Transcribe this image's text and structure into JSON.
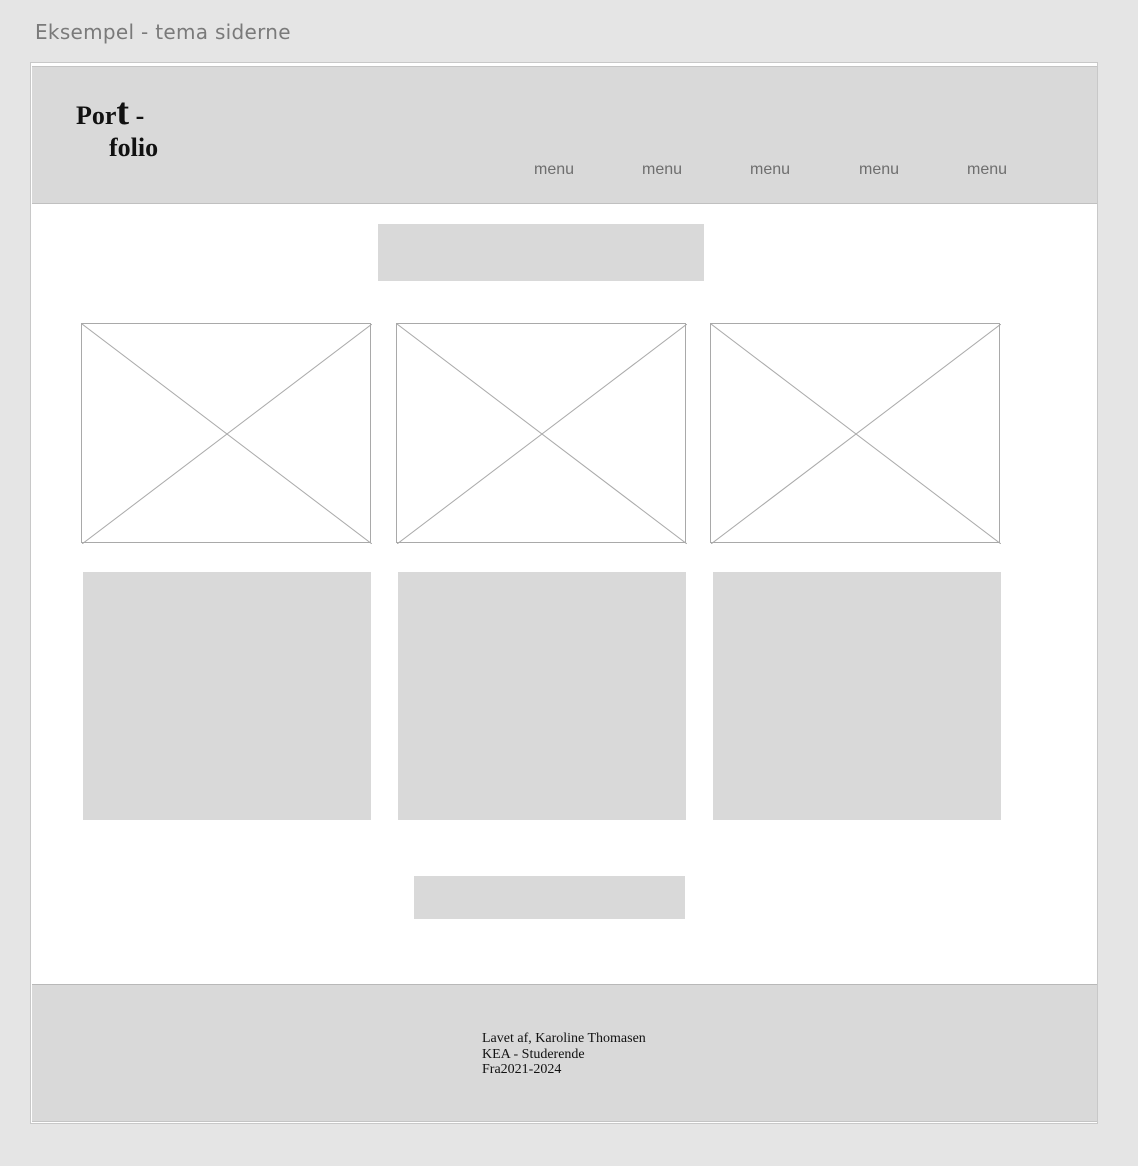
{
  "artboard_title": "Eksempel - tema siderne",
  "header": {
    "logo": {
      "line1_start": "Por",
      "line1_big": "t",
      "line1_end": " -",
      "line2": "folio"
    },
    "menu": [
      "menu",
      "menu",
      "menu",
      "menu",
      "menu"
    ]
  },
  "footer": {
    "lines": [
      "Lavet af, Karoline Thomasen",
      "KEA - Studerende",
      "Fra2021-2024"
    ]
  },
  "colors": {
    "page": "#e5e5e5",
    "artboard": "#ffffff",
    "block": "#d9d9d9",
    "text": "#111111",
    "menu": "#6e6e6e"
  }
}
